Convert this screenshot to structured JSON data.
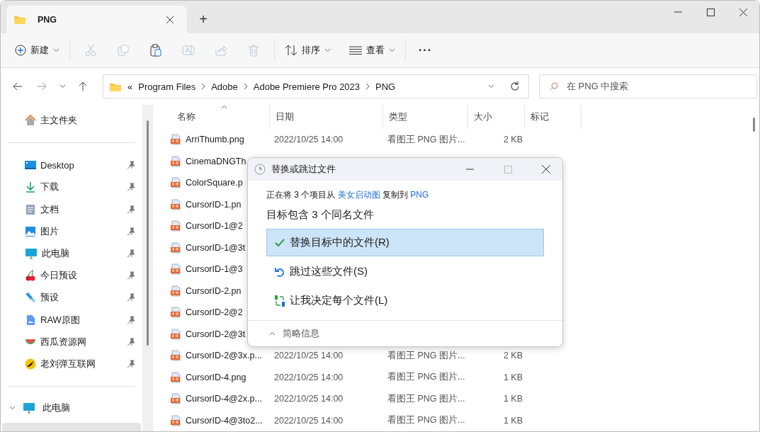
{
  "window": {
    "tabs": [
      {
        "label": "PNG",
        "selected": true
      }
    ],
    "new_tab": "+"
  },
  "toolbar": {
    "new": "新建",
    "actions": [
      {
        "kind": "cut",
        "disabled": true
      },
      {
        "kind": "copy",
        "disabled": true
      },
      {
        "kind": "paste",
        "disabled": false
      },
      {
        "kind": "rename",
        "disabled": true
      },
      {
        "kind": "share",
        "disabled": true
      },
      {
        "kind": "delete",
        "disabled": true
      }
    ],
    "sort": "排序",
    "view": "查看",
    "more": "···"
  },
  "address": {
    "overflow": "«",
    "crumbs": [
      "Program Files",
      "Adobe",
      "Adobe Premiere Pro 2023",
      "PNG"
    ]
  },
  "search": {
    "placeholder": "在 PNG 中搜索"
  },
  "sidebar": {
    "home": {
      "label": "主文件夹"
    },
    "items": [
      {
        "label": "Desktop",
        "kind": "desktop"
      },
      {
        "label": "下载",
        "kind": "download"
      },
      {
        "label": "文档",
        "kind": "document"
      },
      {
        "label": "图片",
        "kind": "pictures"
      },
      {
        "label": "此电脑",
        "kind": "pc"
      },
      {
        "label": "今日预设",
        "kind": "cherry"
      },
      {
        "label": "预设",
        "kind": "brush"
      },
      {
        "label": "RAW原图",
        "kind": "image"
      },
      {
        "label": "西瓜资源网",
        "kind": "melon"
      },
      {
        "label": "老刘弹互联网",
        "kind": "badge"
      }
    ],
    "this_pc": {
      "label": "此电脑",
      "expanded": true
    }
  },
  "table": {
    "columns": [
      "名称",
      "日期",
      "类型",
      "大小",
      "标记"
    ],
    "rows": [
      {
        "name": "ArriThumb.png",
        "date": "2022/10/25 14:00",
        "type": "看图王 PNG 图片...",
        "size": "2 KB"
      },
      {
        "name": "CinemaDNGTh"
      },
      {
        "name": "ColorSquare.p"
      },
      {
        "name": "CursorID-1.pn"
      },
      {
        "name": "CursorID-1@2"
      },
      {
        "name": "CursorID-1@3t"
      },
      {
        "name": "CursorID-1@3"
      },
      {
        "name": "CursorID-2.pn"
      },
      {
        "name": "CursorID-2@2"
      },
      {
        "name": "CursorID-2@3t"
      },
      {
        "name": "CursorID-2@3x.p...",
        "date": "2022/10/25 14:00",
        "type": "看图王 PNG 图片...",
        "size": "2 KB"
      },
      {
        "name": "CursorID-4.png",
        "date": "2022/10/25 14:00",
        "type": "看图王 PNG 图片...",
        "size": "1 KB"
      },
      {
        "name": "CursorID-4@2x.p...",
        "date": "2022/10/25 14:00",
        "type": "看图王 PNG 图片...",
        "size": "1 KB"
      },
      {
        "name": "CursorID-4@3to2...",
        "date": "2022/10/25 14:00",
        "type": "看图王 PNG 图片...",
        "size": "1 KB"
      }
    ]
  },
  "dialog": {
    "title": "替换或跳过文件",
    "status": [
      {
        "text": "正在将 3 个项目从 ",
        "link": false
      },
      {
        "text": "美女启动图",
        "link": true
      },
      {
        "text": " 复制到 ",
        "link": false
      },
      {
        "text": "PNG",
        "link": true
      }
    ],
    "heading": "目标包含 3 个同名文件",
    "options": [
      {
        "label": "替换目标中的文件(R)",
        "kind": "replace",
        "selected": true
      },
      {
        "label": "跳过这些文件(S)",
        "kind": "skip",
        "selected": false
      },
      {
        "label": "让我决定每个文件(L)",
        "kind": "decide",
        "selected": false
      }
    ],
    "details": "简略信息"
  }
}
